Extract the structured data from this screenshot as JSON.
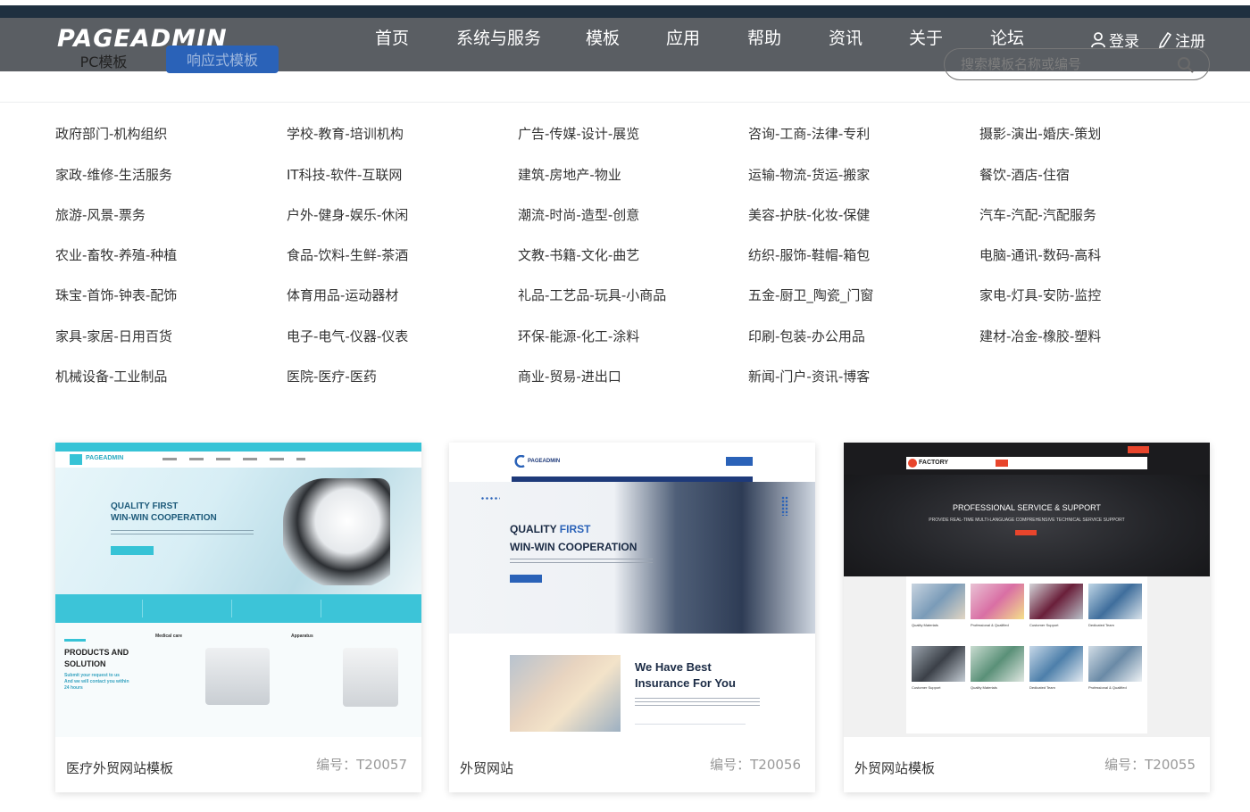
{
  "header": {
    "logo": "PAGEADMIN",
    "nav": [
      "首页",
      "系统与服务",
      "模板",
      "应用",
      "帮助",
      "资讯",
      "关于",
      "论坛"
    ],
    "login": "登录",
    "register": "注册",
    "tabs": {
      "pc": "PC模板",
      "responsive": "响应式模板"
    },
    "search_placeholder": "搜索模板名称或编号"
  },
  "categories": [
    [
      "政府部门-机构组织",
      "学校-教育-培训机构",
      "广告-传媒-设计-展览",
      "咨询-工商-法律-专利",
      "摄影-演出-婚庆-策划"
    ],
    [
      "家政-维修-生活服务",
      "IT科技-软件-互联网",
      "建筑-房地产-物业",
      "运输-物流-货运-搬家",
      "餐饮-酒店-住宿"
    ],
    [
      "旅游-风景-票务",
      "户外-健身-娱乐-休闲",
      "潮流-时尚-造型-创意",
      "美容-护肤-化妆-保健",
      "汽车-汽配-汽配服务"
    ],
    [
      "农业-畜牧-养殖-种植",
      "食品-饮料-生鲜-茶酒",
      "文教-书籍-文化-曲艺",
      "纺织-服饰-鞋帽-箱包",
      "电脑-通讯-数码-高科"
    ],
    [
      "珠宝-首饰-钟表-配饰",
      "体育用品-运动器材",
      "礼品-工艺品-玩具-小商品",
      "五金-厨卫_陶瓷_门窗",
      "家电-灯具-安防-监控"
    ],
    [
      "家具-家居-日用百货",
      "电子-电气-仪器-仪表",
      "环保-能源-化工-涂料",
      "印刷-包装-办公用品",
      "建材-冶金-橡胶-塑料"
    ],
    [
      "机械设备-工业制品",
      "医院-医疗-医药",
      "商业-贸易-进出口",
      "新闻-门户-资讯-博客"
    ]
  ],
  "templates": [
    {
      "name": "医疗外贸网站模板",
      "code": "编号：T20057",
      "shot": {
        "brand": "PAGEADMIN",
        "headline1": "QUALITY FIRST",
        "headline2": "WIN-WIN COOPERATION",
        "section1": "PRODUCTS AND",
        "section2": "SOLUTION",
        "sub1": "Submit your request to us",
        "sub2": "And we will contact you within",
        "sub3": "24 hours",
        "col1": "Medical care",
        "col2": "Apparatus"
      }
    },
    {
      "name": "外贸网站",
      "code": "编号：T20056",
      "shot": {
        "brand": "PAGEADMIN",
        "headline1a": "QUALITY ",
        "headline1b": "FIRST",
        "headline2": "WIN-WIN COOPERATION",
        "promo1": "We Have Best",
        "promo2": "Insurance For You"
      }
    },
    {
      "name": "外贸网站模板",
      "code": "编号：T20055",
      "shot": {
        "brand": "FACTORY",
        "headline": "PROFESSIONAL SERVICE & SUPPORT",
        "subline": "PROVIDE REAL-TIME MULTI-LANGUAGE COMPREHENSIVE TECHNICAL SERVICE SUPPORT",
        "captions": [
          "Quality Materials",
          "Professional & Qualified",
          "Customer Support",
          "Dedicated Team",
          "Customer Support",
          "Quality Materials",
          "Dedicated Team",
          "Professional & Qualified"
        ]
      }
    }
  ],
  "colors": {
    "header_bg": "#5a5e63",
    "header_strip": "#1f3040",
    "accent_blue": "#2a62b8",
    "teal": "#36c3d6"
  }
}
